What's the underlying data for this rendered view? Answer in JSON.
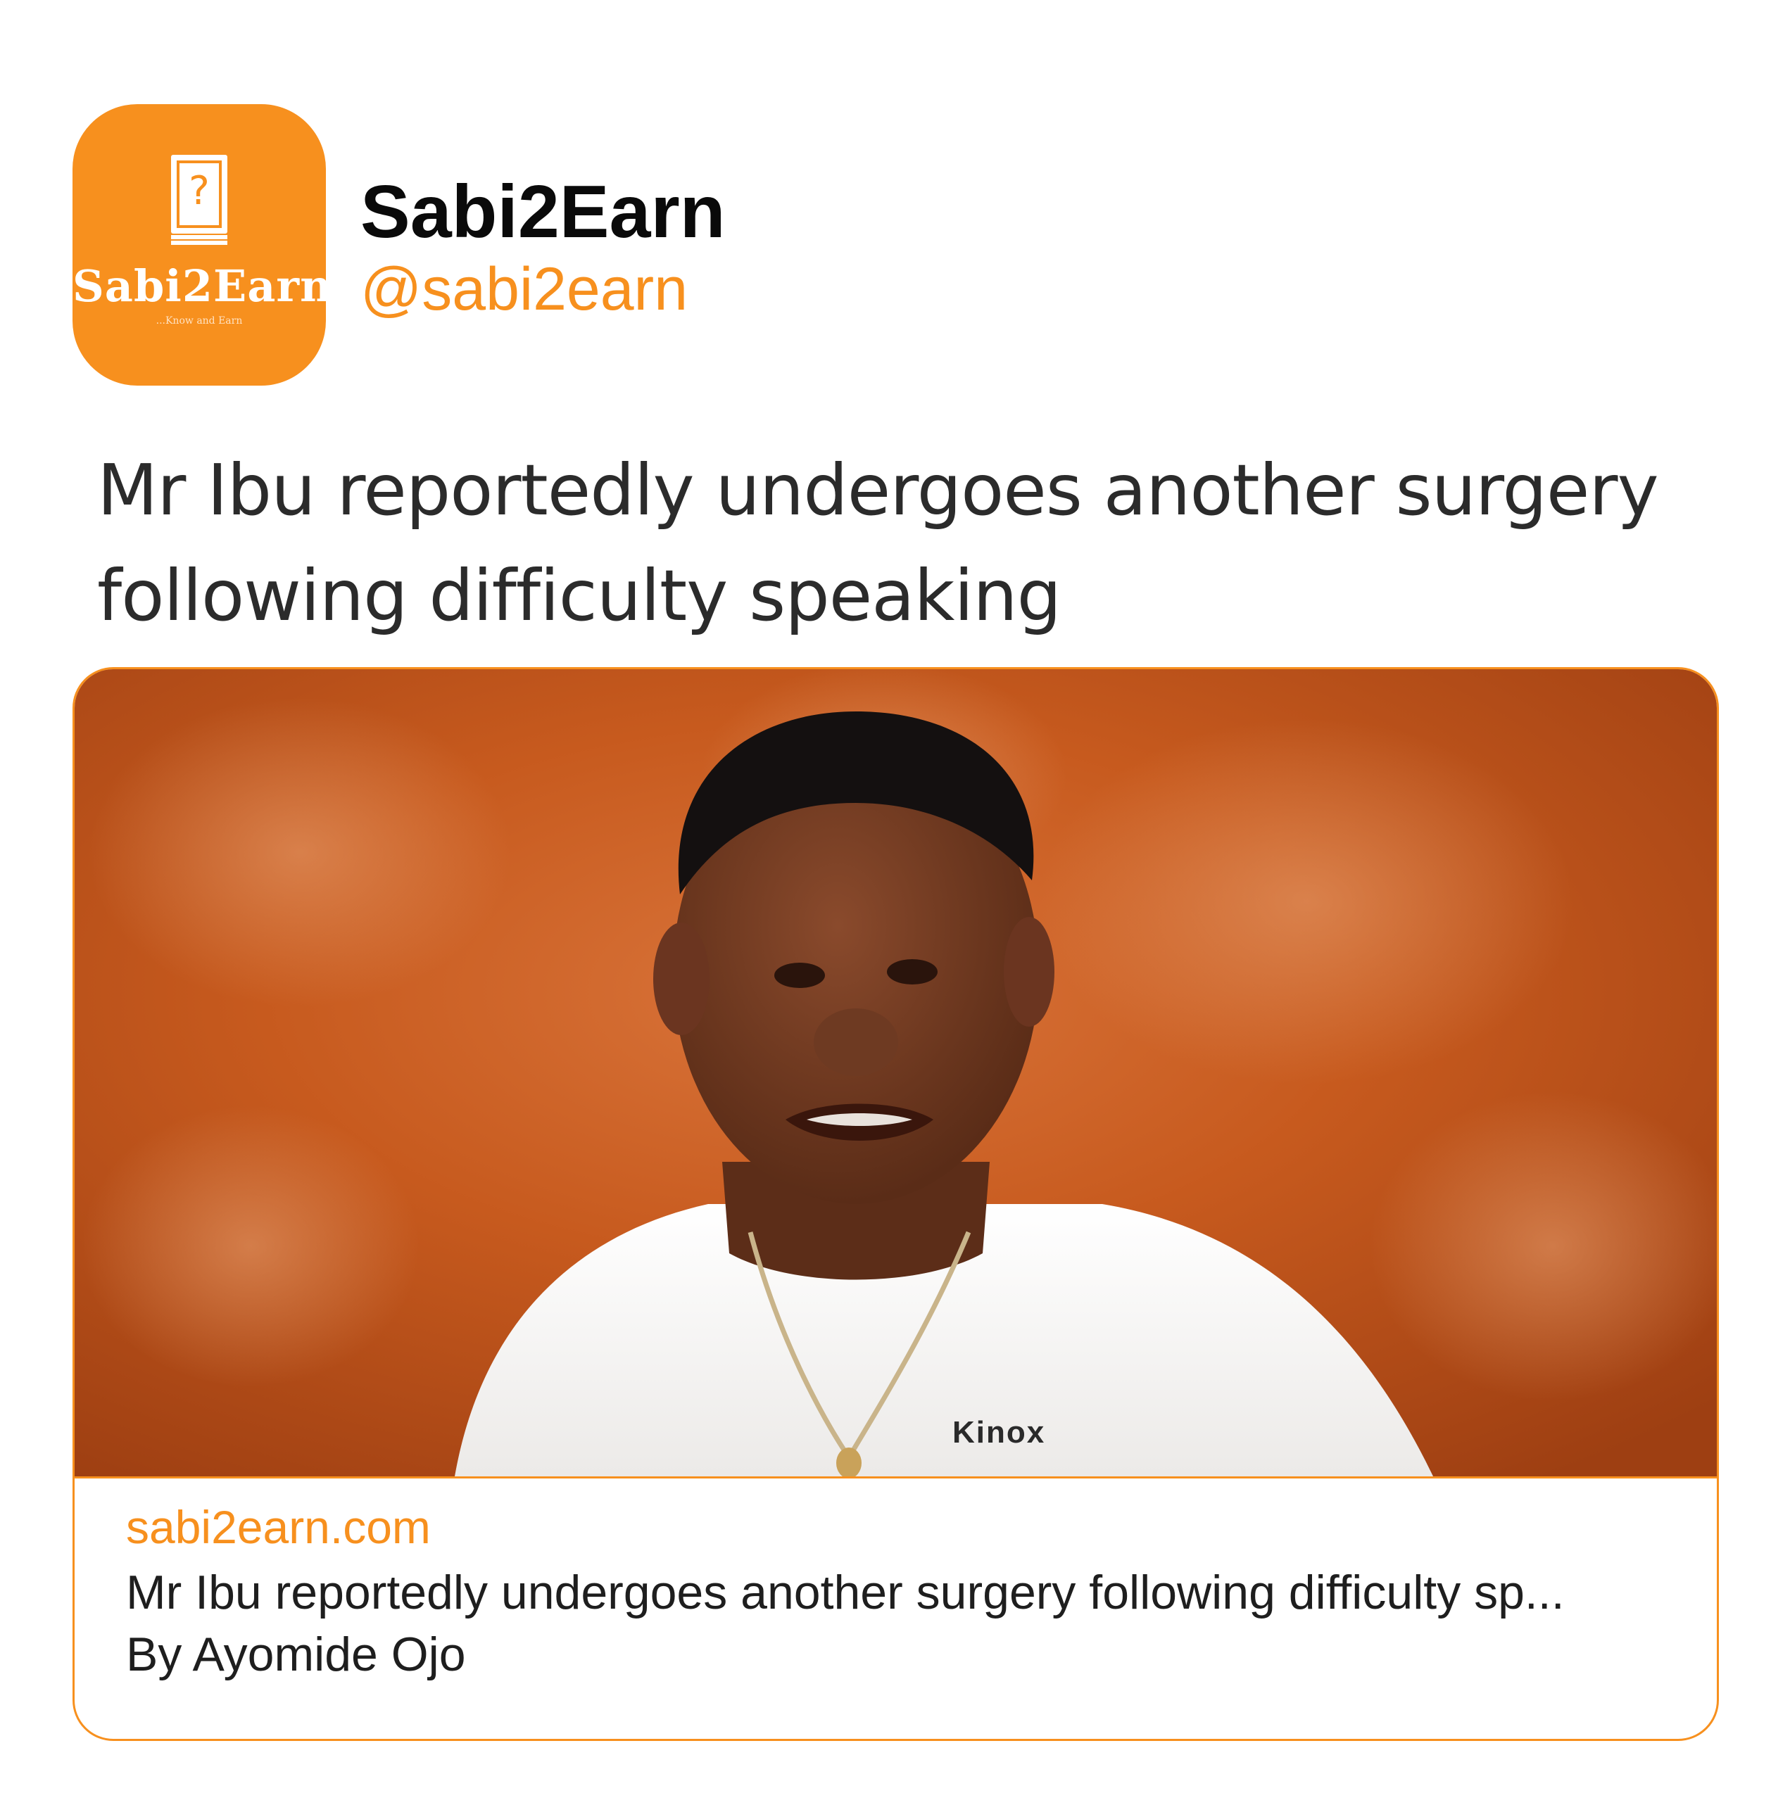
{
  "profile": {
    "avatar_logo_text": "Sabi2Earn",
    "avatar_tagline": "...Know and Earn",
    "avatar_icon": "question-book-icon",
    "display_name": "Sabi2Earn",
    "handle": "@sabi2earn"
  },
  "post": {
    "text": "Mr Ibu reportedly undergoes another surgery following difficulty speaking"
  },
  "link_card": {
    "image": {
      "shirt_brand_text": "Kinox"
    },
    "domain": "sabi2earn.com",
    "title": "Mr Ibu reportedly undergoes another surgery following difficulty sp...",
    "byline": "By Ayomide Ojo"
  },
  "colors": {
    "brand_orange": "#f7901e",
    "text_dark": "#0a0a0a",
    "text_body": "#2b2b2b",
    "background": "#ffffff"
  }
}
